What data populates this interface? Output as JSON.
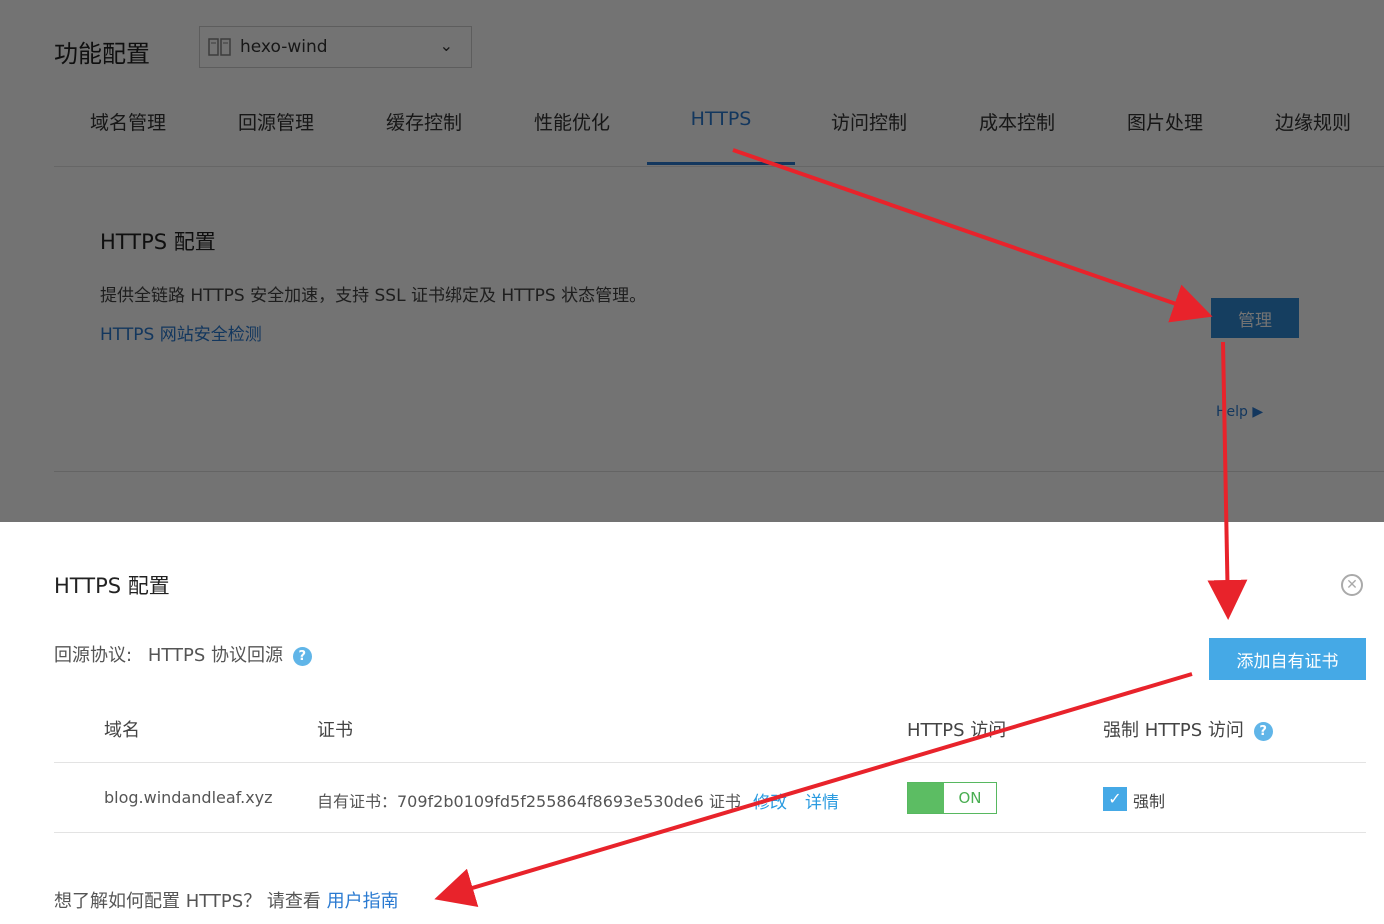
{
  "header": {
    "title": "功能配置",
    "domain_select": {
      "value": "hexo-wind"
    }
  },
  "tabs": [
    {
      "label": "域名管理"
    },
    {
      "label": "回源管理"
    },
    {
      "label": "缓存控制"
    },
    {
      "label": "性能优化"
    },
    {
      "label": "HTTPS",
      "active": true
    },
    {
      "label": "访问控制"
    },
    {
      "label": "成本控制"
    },
    {
      "label": "图片处理"
    },
    {
      "label": "边缘规则"
    }
  ],
  "https_section": {
    "title": "HTTPS 配置",
    "description": "提供全链路 HTTPS 安全加速，支持 SSL 证书绑定及 HTTPS 状态管理。",
    "check_link": "HTTPS 网站安全检测",
    "manage_button": "管理",
    "help_link": "Help ▶"
  },
  "panel": {
    "title": "HTTPS 配置",
    "protocol_label": "回源协议:",
    "protocol_value": "HTTPS 协议回源",
    "add_cert_button": "添加自有证书",
    "columns": {
      "domain": "域名",
      "cert": "证书",
      "https_access": "HTTPS 访问",
      "force_https": "强制 HTTPS 访问"
    },
    "row": {
      "domain": "blog.windandleaf.xyz",
      "cert": "自有证书：709f2b0109fd5f255864f8693e530de6 证书",
      "edit_link": "修改",
      "detail_link": "详情",
      "switch_label": "ON",
      "force_label": "强制"
    },
    "footer_text": "想了解如何配置 HTTPS？ 请查看",
    "footer_link": "用户指南"
  },
  "colors": {
    "accent": "#2a7ad1",
    "button_blue": "#45a9e6",
    "switch_green": "#5cbd63",
    "arrow_red": "#e8232b"
  }
}
